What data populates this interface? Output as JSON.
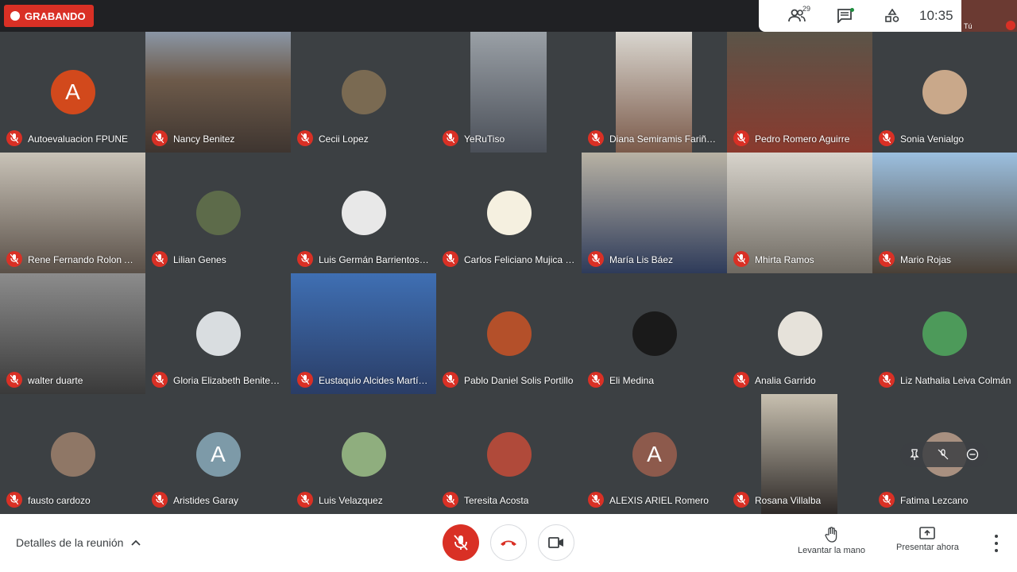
{
  "recording": {
    "label": "GRABANDO"
  },
  "top": {
    "participants_count": "29",
    "time": "10:35",
    "self_label": "Tú"
  },
  "tiles": [
    {
      "name": "Autoevaluacion FPUNE",
      "initial": "A",
      "avatar_color": "#d2491c"
    },
    {
      "name": "Nancy Benitez"
    },
    {
      "name": "Cecii Lopez"
    },
    {
      "name": "YeRuTiso"
    },
    {
      "name": "Diana Semiramis Fariña ..."
    },
    {
      "name": "Pedro Romero Aguirre"
    },
    {
      "name": "Sonia Venialgo"
    },
    {
      "name": "Rene Fernando Rolon Al..."
    },
    {
      "name": "Lilian Genes"
    },
    {
      "name": "Luis Germán Barrientos ..."
    },
    {
      "name": "Carlos Feliciano Mujica R..."
    },
    {
      "name": "María Lis Báez"
    },
    {
      "name": "Mhirta Ramos"
    },
    {
      "name": "Mario Rojas"
    },
    {
      "name": "walter duarte"
    },
    {
      "name": "Gloria Elizabeth Benitez ..."
    },
    {
      "name": "Eustaquio Alcides Martín..."
    },
    {
      "name": "Pablo Daniel Solis Portillo"
    },
    {
      "name": "Eli Medina"
    },
    {
      "name": "Analia Garrido"
    },
    {
      "name": "Liz Nathalia Leiva Colmán"
    },
    {
      "name": "fausto cardozo"
    },
    {
      "name": "Aristides Garay",
      "initial": "A",
      "avatar_color": "#7d9aa8"
    },
    {
      "name": "Luis Velazquez"
    },
    {
      "name": "Teresita Acosta"
    },
    {
      "name": "ALEXIS ARIEL Romero",
      "initial": "A",
      "avatar_color": "#8d5a4c"
    },
    {
      "name": "Rosana Villalba"
    },
    {
      "name": "Fatima Lezcano"
    }
  ],
  "bottom": {
    "details_label": "Detalles de la reunión",
    "raise_hand_label": "Levantar la mano",
    "present_label": "Presentar ahora"
  },
  "icons": {
    "participants": "people-icon",
    "chat": "chat-icon",
    "activities": "shapes-icon",
    "mic_off": "mic-off-icon",
    "end_call": "phone-hangup-icon",
    "camera": "videocam-icon",
    "raise_hand": "hand-icon",
    "present": "present-icon",
    "more": "more-vert-icon"
  },
  "colors": {
    "muted_red": "#d93025",
    "background": "#202124",
    "tile": "#3c4043"
  }
}
